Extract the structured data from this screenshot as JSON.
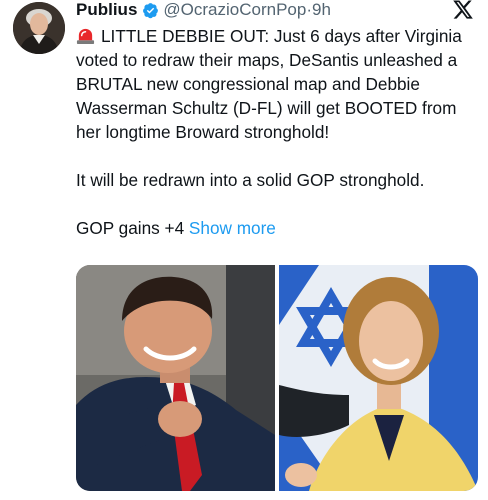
{
  "tweet": {
    "author_name": "Publius",
    "handle": "@OcrazioCornPop",
    "separator": "·",
    "time": "9h",
    "icons": {
      "avatar": "profile-portrait",
      "verified": "verified-badge-icon",
      "siren": "police-siren-emoji",
      "platform": "x-logo-icon"
    },
    "body": {
      "paragraph1": "LITTLE DEBBIE OUT: Just 6 days after Virginia voted to redraw their maps, DeSantis unleashed a BRUTAL new congressional map and Debbie Wasserman Schultz (D-FL) will get BOOTED from her longtime Broward stronghold!",
      "paragraph2": "It will be redrawn into a solid GOP stronghold.",
      "paragraph3": "GOP gains +4",
      "show_more": "Show more"
    },
    "media": [
      {
        "subject": "man-in-suit-pointing"
      },
      {
        "subject": "woman-with-flag-background"
      }
    ]
  },
  "colors": {
    "text": "#0f1419",
    "secondary": "#536471",
    "link": "#1d9bf0",
    "verified": "#1d9bf0"
  }
}
